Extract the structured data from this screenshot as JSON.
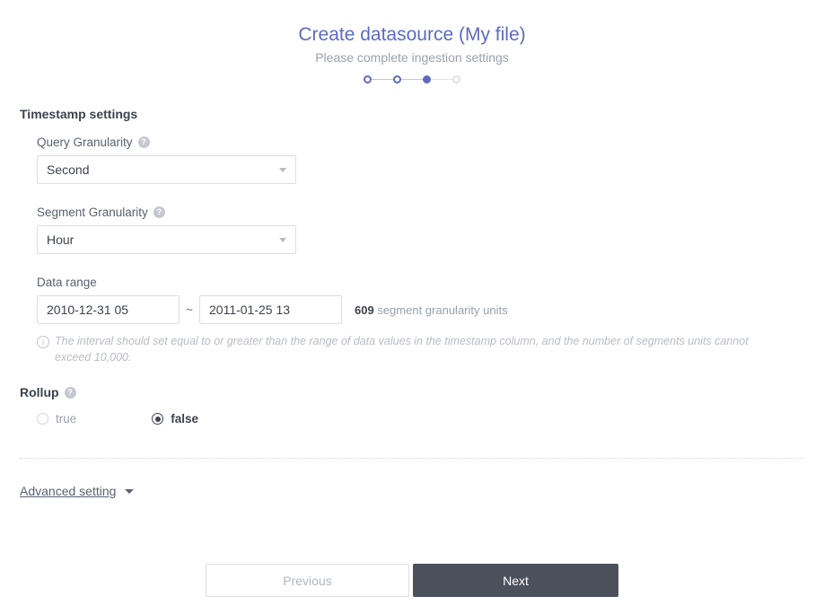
{
  "header": {
    "title": "Create datasource (My file)",
    "subtitle": "Please complete ingestion settings",
    "accent_color": "#5c6bbf",
    "steps": [
      {
        "name": "step-1",
        "state": "done"
      },
      {
        "name": "step-2",
        "state": "done"
      },
      {
        "name": "step-3",
        "state": "active"
      },
      {
        "name": "step-4",
        "state": "pending"
      }
    ]
  },
  "timestamp_section": {
    "heading": "Timestamp settings",
    "query_granularity": {
      "label": "Query Granularity",
      "help_icon": "question-mark-icon",
      "value": "Second"
    },
    "segment_granularity": {
      "label": "Segment Granularity",
      "help_icon": "question-mark-icon",
      "value": "Hour"
    },
    "data_range": {
      "label": "Data range",
      "start_value": "2010-12-31 05",
      "separator": "~",
      "end_value": "2011-01-25 13",
      "units_count": "609",
      "units_label": "segment granularity units"
    },
    "hint": {
      "icon": "info-circle-icon",
      "text": "The interval should set equal to or greater than the range of data values in the timestamp column, and the number of segments units cannot exceed 10,000."
    }
  },
  "rollup_section": {
    "heading": "Rollup",
    "help_icon": "question-mark-icon",
    "options": [
      {
        "label": "true",
        "selected": false
      },
      {
        "label": "false",
        "selected": true
      }
    ]
  },
  "advanced": {
    "label": "Advanced setting",
    "caret_icon": "chevron-down-icon"
  },
  "footer": {
    "previous_label": "Previous",
    "next_label": "Next",
    "next_color": "#4b505b"
  }
}
